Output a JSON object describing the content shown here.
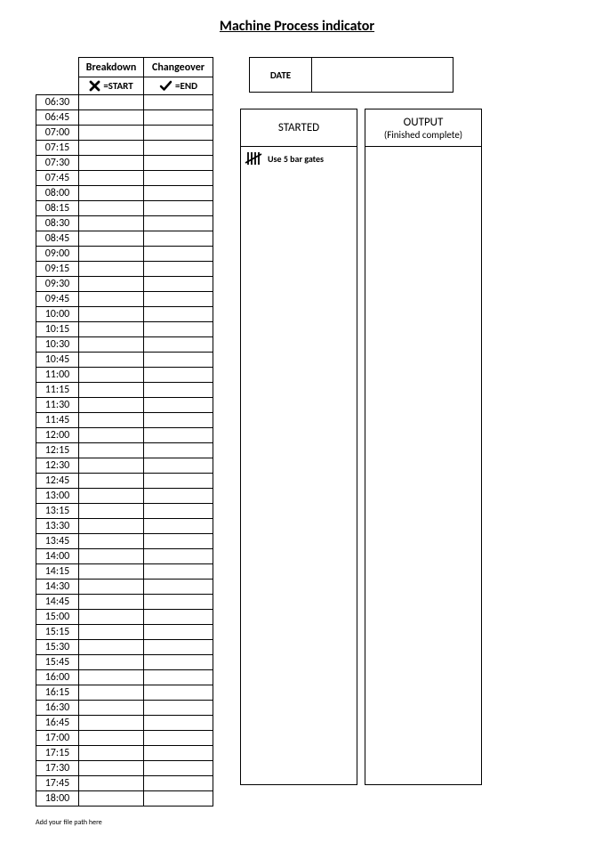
{
  "title": "Machine Process indicator",
  "table": {
    "headers": {
      "breakdown": "Breakdown",
      "changeover": "Changeover"
    },
    "legend": {
      "start": "=START",
      "end": "=END"
    },
    "times": [
      "06:30",
      "06:45",
      "07:00",
      "07:15",
      "07:30",
      "07:45",
      "08:00",
      "08:15",
      "08:30",
      "08:45",
      "09:00",
      "09:15",
      "09:30",
      "09:45",
      "10:00",
      "10:15",
      "10:30",
      "10:45",
      "11:00",
      "11:15",
      "11:30",
      "11:45",
      "12:00",
      "12:15",
      "12:30",
      "12:45",
      "13:00",
      "13:15",
      "13:30",
      "13:45",
      "14:00",
      "14:15",
      "14:30",
      "14:45",
      "15:00",
      "15:15",
      "15:30",
      "15:45",
      "16:00",
      "16:15",
      "16:30",
      "16:45",
      "17:00",
      "17:15",
      "17:30",
      "17:45",
      "18:00"
    ]
  },
  "date": {
    "label": "DATE",
    "value": ""
  },
  "started": {
    "header": "STARTED",
    "tally_hint": "Use 5 bar gates"
  },
  "output": {
    "header": "OUTPUT",
    "subheader": "(Finished complete)"
  },
  "footer": "Add your file path here",
  "icons": {
    "x": "x-mark-icon",
    "check": "check-icon",
    "tally": "tally-five-icon"
  }
}
